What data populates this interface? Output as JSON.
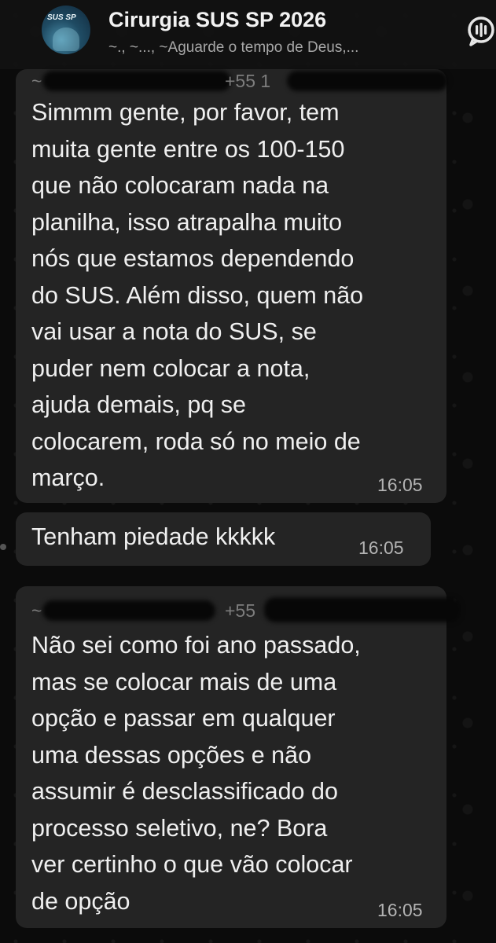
{
  "chat": {
    "title": "Cirurgia SUS SP 2026",
    "subtitle": "~., ~..., ~Aguarde o tempo de Deus,...",
    "avatar_text": "SUS SP"
  },
  "messages": [
    {
      "sender_prefix": "~",
      "phone_prefix": "+55 1",
      "text": "Simmm gente, por favor, tem\nmuita gente entre os 100-150\nque não colocaram nada na\nplanilha, isso atrapalha muito\nnós que estamos dependendo\ndo SUS. Além disso, quem não\nvai usar a nota do SUS, se\npuder nem colocar a nota,\najuda demais, pq se\ncolocarem, roda só no meio de\nmarço.",
      "time": "16:05"
    },
    {
      "text": "Tenham piedade kkkkk",
      "time": "16:05"
    },
    {
      "sender_prefix": "~",
      "phone_prefix": "+55",
      "text": "Não sei como foi ano passado,\nmas se colocar mais de uma\nopção e passar em qualquer\numa dessas opções e não\nassumir é desclassificado do\nprocesso seletivo, ne? Bora\nver certinho o que vão colocar\nde opção",
      "time": "16:05"
    }
  ],
  "icons": [
    "group-avatar",
    "voice-chat-icon"
  ],
  "colors": {
    "background": "#0b0b0b",
    "bubble": "#242424",
    "text": "#efefef",
    "time": "#b3b3b3"
  }
}
